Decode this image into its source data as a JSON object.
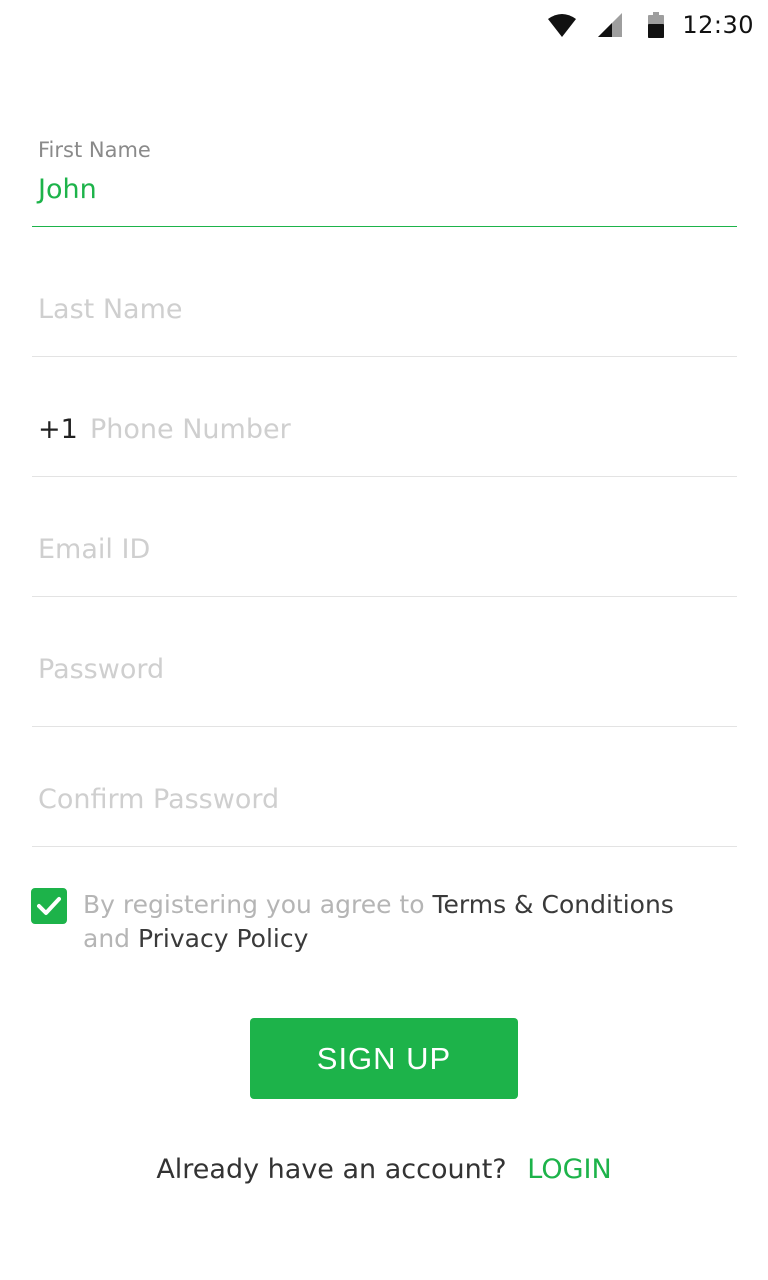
{
  "status_bar": {
    "time": "12:30",
    "icons": [
      "wifi-icon",
      "cell-signal-icon",
      "battery-icon"
    ]
  },
  "form": {
    "first_name": {
      "label": "First Name",
      "value": "John"
    },
    "last_name": {
      "placeholder": "Last Name"
    },
    "phone": {
      "prefix": "+1",
      "placeholder": "Phone Number"
    },
    "email": {
      "placeholder": "Email ID"
    },
    "password": {
      "placeholder": "Password"
    },
    "confirm_password": {
      "placeholder": "Confirm Password"
    }
  },
  "terms": {
    "checked": true,
    "text_before": "By registering you agree to",
    "terms_link": "Terms & Conditions",
    "and_text": "and",
    "privacy_link": "Privacy Policy"
  },
  "signup_button_label": "SIGN UP",
  "login_prompt": {
    "text": "Already have an account?",
    "link": "LOGIN"
  },
  "colors": {
    "accent": "#1db34a",
    "placeholder": "#cfcfcf",
    "divider": "#e3e3e3"
  }
}
